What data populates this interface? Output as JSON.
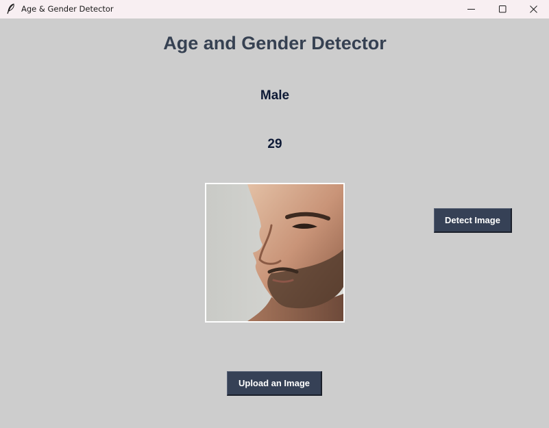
{
  "window": {
    "title": "Age & Gender Detector",
    "icon": "feather-icon",
    "controls": [
      "minimize-icon",
      "maximize-icon",
      "close-icon"
    ]
  },
  "main": {
    "heading": "Age and Gender Detector",
    "gender": "Male",
    "age": "29",
    "photo": "face-photo-profile-man",
    "detect_button": "Detect Image",
    "upload_button": "Upload an Image"
  },
  "colors": {
    "background": "#cdcdcd",
    "titlebar": "#f8eff2",
    "heading": "#364152",
    "result_text": "#0e1a36",
    "button": "#364156",
    "button_text": "#ffffff"
  }
}
